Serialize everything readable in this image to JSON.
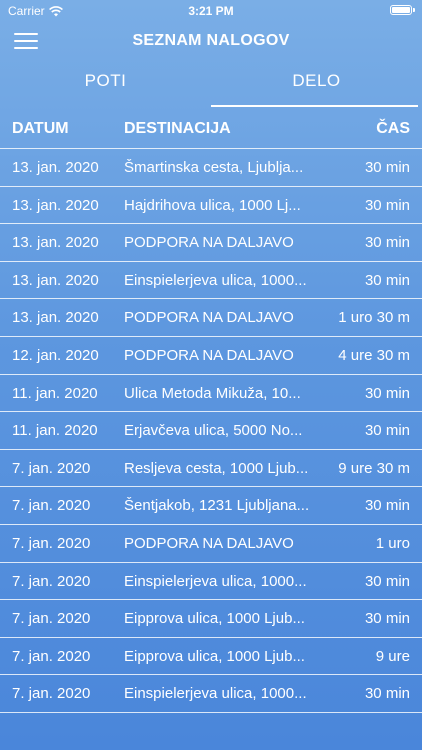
{
  "status_bar": {
    "carrier": "Carrier",
    "time": "3:21 PM"
  },
  "nav": {
    "title": "SEZNAM NALOGOV"
  },
  "tabs": [
    {
      "label": "POTI"
    },
    {
      "label": "DELO"
    }
  ],
  "table": {
    "headers": {
      "date": "DATUM",
      "destination": "DESTINACIJA",
      "time": "ČAS"
    },
    "rows": [
      {
        "date": "13. jan. 2020",
        "destination": "Šmartinska cesta, Ljublja...",
        "time": "30 min"
      },
      {
        "date": "13. jan. 2020",
        "destination": "Hajdrihova ulica, 1000 Lj...",
        "time": "30 min"
      },
      {
        "date": "13. jan. 2020",
        "destination": "PODPORA NA DALJAVO",
        "time": "30 min"
      },
      {
        "date": "13. jan. 2020",
        "destination": "Einspielerjeva ulica, 1000...",
        "time": "30 min"
      },
      {
        "date": "13. jan. 2020",
        "destination": "PODPORA NA DALJAVO",
        "time": "1 uro 30 m"
      },
      {
        "date": "12. jan. 2020",
        "destination": "PODPORA NA DALJAVO",
        "time": "4 ure 30 m"
      },
      {
        "date": "11. jan. 2020",
        "destination": "Ulica Metoda Mikuža, 10...",
        "time": "30 min"
      },
      {
        "date": "11. jan. 2020",
        "destination": "Erjavčeva ulica, 5000 No...",
        "time": "30 min"
      },
      {
        "date": "7. jan. 2020",
        "destination": "Resljeva cesta, 1000 Ljub...",
        "time": "9 ure 30 m"
      },
      {
        "date": "7. jan. 2020",
        "destination": "Šentjakob, 1231 Ljubljana...",
        "time": "30 min"
      },
      {
        "date": "7. jan. 2020",
        "destination": "PODPORA NA DALJAVO",
        "time": "1 uro"
      },
      {
        "date": "7. jan. 2020",
        "destination": "Einspielerjeva ulica, 1000...",
        "time": "30 min"
      },
      {
        "date": "7. jan. 2020",
        "destination": "Eipprova ulica, 1000 Ljub...",
        "time": "30 min"
      },
      {
        "date": "7. jan. 2020",
        "destination": "Eipprova ulica, 1000 Ljub...",
        "time": "9 ure"
      },
      {
        "date": "7. jan. 2020",
        "destination": "Einspielerjeva ulica, 1000...",
        "time": "30 min"
      }
    ]
  }
}
